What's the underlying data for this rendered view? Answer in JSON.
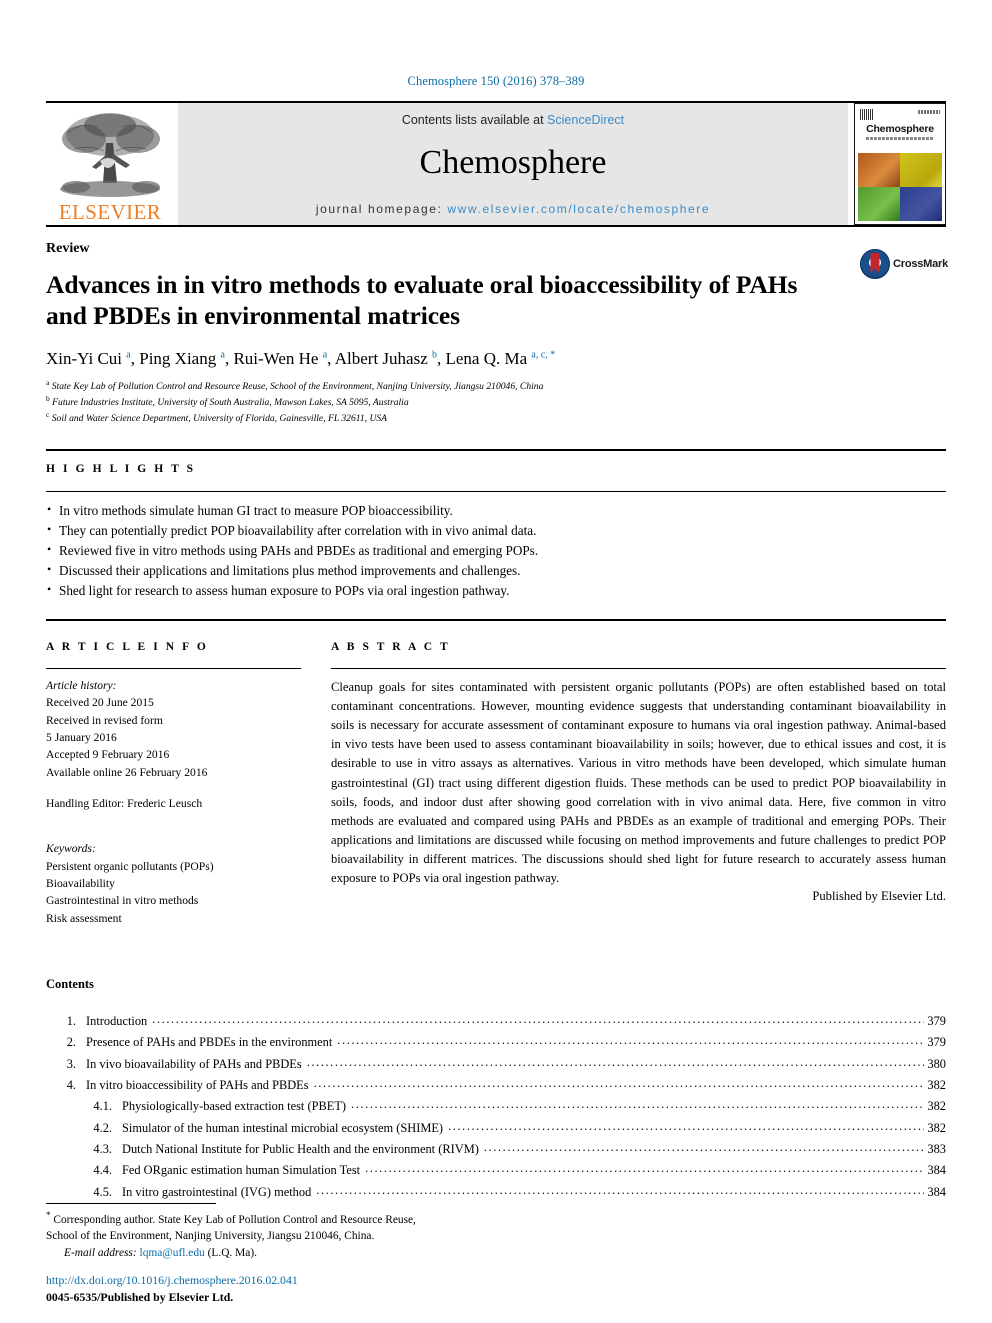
{
  "running_head": "Chemosphere 150 (2016) 378–389",
  "masthead": {
    "publisher_wordmark": "ELSEVIER",
    "contents_prefix": "Contents lists available at",
    "contents_link": "ScienceDirect",
    "journal_name": "Chemosphere",
    "homepage_label": "journal homepage:",
    "homepage_url": "www.elsevier.com/locate/chemosphere",
    "cover": {
      "title": "Chemosphere",
      "subtitle": "Environmental Toxicology and Risk Assessment"
    }
  },
  "article": {
    "doctype": "Review",
    "title": "Advances in in vitro methods to evaluate oral bioaccessibility of PAHs and PBDEs in environmental matrices",
    "crossmark_label": "CrossMark",
    "authors_html": "Xin-Yi Cui <sup>a</sup>, Ping Xiang <sup>a</sup>, Rui-Wen He <sup>a</sup>, Albert Juhasz <sup>b</sup>, Lena Q. Ma <sup>a, c, *</sup>",
    "affiliations": [
      {
        "marker": "a",
        "text": "State Key Lab of Pollution Control and Resource Reuse, School of the Environment, Nanjing University, Jiangsu 210046, China"
      },
      {
        "marker": "b",
        "text": "Future Industries Institute, University of South Australia, Mawson Lakes, SA 5095, Australia"
      },
      {
        "marker": "c",
        "text": "Soil and Water Science Department, University of Florida, Gainesville, FL 32611, USA"
      }
    ]
  },
  "highlights": {
    "label": "H I G H L I G H T S",
    "items": [
      "In vitro methods simulate human GI tract to measure POP bioaccessibility.",
      "They can potentially predict POP bioavailability after correlation with in vivo animal data.",
      "Reviewed five in vitro methods using PAHs and PBDEs as traditional and emerging POPs.",
      "Discussed their applications and limitations plus method improvements and challenges.",
      "Shed light for research to assess human exposure to POPs via oral ingestion pathway."
    ]
  },
  "article_info": {
    "label": "A R T I C L E   I N F O",
    "history_label": "Article history:",
    "history": [
      "Received 20 June 2015",
      "Received in revised form",
      "5 January 2016",
      "Accepted 9 February 2016",
      "Available online 26 February 2016"
    ],
    "handling_editor": "Handling Editor: Frederic Leusch",
    "keywords_label": "Keywords:",
    "keywords": [
      "Persistent organic pollutants (POPs)",
      "Bioavailability",
      "Gastrointestinal in vitro methods",
      "Risk assessment"
    ]
  },
  "abstract": {
    "label": "A B S T R A C T",
    "text": "Cleanup goals for sites contaminated with persistent organic pollutants (POPs) are often established based on total contaminant concentrations. However, mounting evidence suggests that understanding contaminant bioavailability in soils is necessary for accurate assessment of contaminant exposure to humans via oral ingestion pathway. Animal-based in vivo tests have been used to assess contaminant bioavailability in soils; however, due to ethical issues and cost, it is desirable to use in vitro assays as alternatives. Various in vitro methods have been developed, which simulate human gastrointestinal (GI) tract using different digestion fluids. These methods can be used to predict POP bioavailability in soils, foods, and indoor dust after showing good correlation with in vivo animal data. Here, five common in vitro methods are evaluated and compared using PAHs and PBDEs as an example of traditional and emerging POPs. Their applications and limitations are discussed while focusing on method improvements and future challenges to predict POP bioavailability in different matrices. The discussions should shed light for future research to accurately assess human exposure to POPs via oral ingestion pathway.",
    "publisher_line": "Published by Elsevier Ltd."
  },
  "contents": {
    "title": "Contents",
    "entries": [
      {
        "num": "1.",
        "label": "Introduction",
        "page": "379",
        "sub": false
      },
      {
        "num": "2.",
        "label": "Presence of PAHs and PBDEs in the environment",
        "page": "379",
        "sub": false
      },
      {
        "num": "3.",
        "label": "In vivo bioavailability of PAHs and PBDEs",
        "page": "380",
        "sub": false
      },
      {
        "num": "4.",
        "label": "In vitro bioaccessibility of PAHs and PBDEs",
        "page": "382",
        "sub": false
      },
      {
        "num": "4.1.",
        "label": "Physiologically-based extraction test (PBET)",
        "page": "382",
        "sub": true
      },
      {
        "num": "4.2.",
        "label": "Simulator of the human intestinal microbial ecosystem (SHIME)",
        "page": "382",
        "sub": true
      },
      {
        "num": "4.3.",
        "label": "Dutch National Institute for Public Health and the environment (RIVM)",
        "page": "383",
        "sub": true
      },
      {
        "num": "4.4.",
        "label": "Fed ORganic estimation human Simulation Test",
        "page": "384",
        "sub": true
      },
      {
        "num": "4.5.",
        "label": "In vitro gastrointestinal (IVG) method",
        "page": "384",
        "sub": true
      }
    ]
  },
  "footer": {
    "corresponding_1": "Corresponding author. State Key Lab of Pollution Control and Resource Reuse,",
    "corresponding_2": "School of the Environment, Nanjing University, Jiangsu 210046, China.",
    "email_label": "E-mail address:",
    "email": "lqma@ufl.edu",
    "email_owner": "(L.Q. Ma).",
    "doi_url": "http://dx.doi.org/10.1016/j.chemosphere.2016.02.041",
    "issn_line": "0045-6535/Published by Elsevier Ltd."
  },
  "colors": {
    "link_blue": "#0b6ca8",
    "sciencedirect_blue": "#3a8cc8",
    "elsevier_orange": "#ef7d22",
    "banner_gray": "#e6e6e6"
  }
}
